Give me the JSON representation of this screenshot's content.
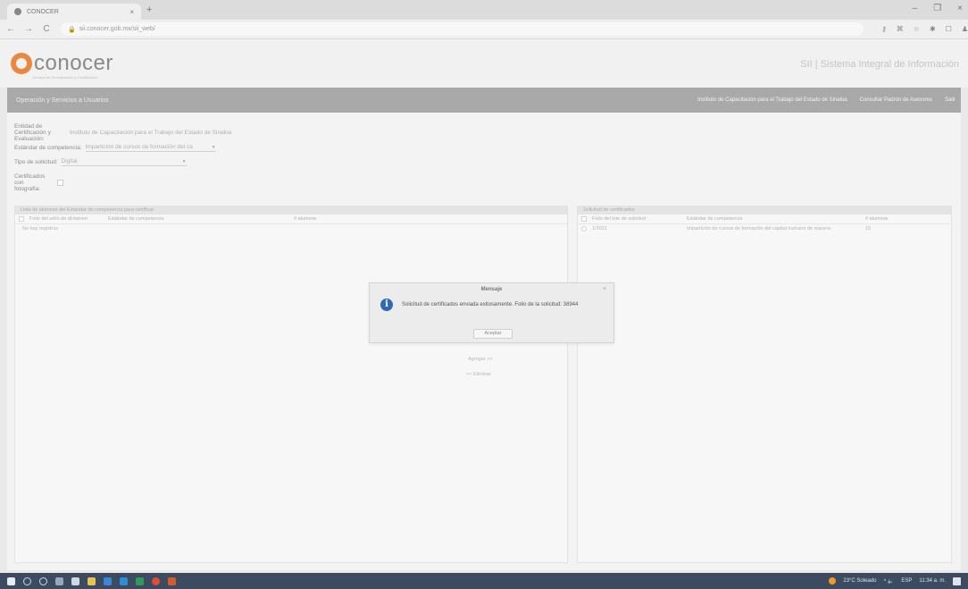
{
  "browser": {
    "tab_title": "CONOCER",
    "tab_close": "×",
    "new_tab": "+",
    "url": "sii.conocer.gob.mx/sii_web/",
    "nav": {
      "back": "←",
      "forward": "→",
      "reload": "C"
    },
    "window_controls": {
      "minimize": "–",
      "maximize": "❐",
      "close": "×"
    }
  },
  "header": {
    "logo_text": "conocer",
    "logo_subtitle": "Consejo de Normalización y Certificación",
    "system_title": "SII | Sistema Integral de Información"
  },
  "menubar": {
    "left_item": "Operación y Servicios a Usuarios",
    "right_items": [
      "Instituto de Capacitación para el Trabajo del Estado de Sinaloa",
      "Consultar Padrón de Asesores",
      "Salir"
    ]
  },
  "form": {
    "entity_label": "Entidad de Certificación y Evaluación:",
    "entity_value": "Instituto de Capacitación para el Trabajo del Estado de Sinaloa",
    "standard_label": "Estándar de competencia:",
    "standard_value": "Impartición de cursos de formación del ca",
    "request_type_label": "Tipo de solicitud:",
    "request_type_value": "Digital",
    "photo_label": "Certificados con fotografía:"
  },
  "left_panel": {
    "title": "Lista de alumnos del Estándar de competencia para certificar",
    "columns": [
      "Folio del sello de dictamen",
      "Estándar de competencia",
      "# alumnos"
    ],
    "empty_text": "No hay registros"
  },
  "right_panel": {
    "title": "Solicitud de certificados",
    "columns": [
      "Folio del lote de solicitud",
      "Estándar de competencia",
      "# alumnos"
    ],
    "rows": [
      {
        "folio": "1/2021",
        "standard": "Impartición de cursos de formación del capital humano de manera",
        "count": "15"
      }
    ]
  },
  "links": {
    "add": "Agregar >>",
    "remove": "<< Eliminar"
  },
  "modal": {
    "title": "Mensaje",
    "close": "×",
    "icon": "info-icon",
    "message": "Solicitud de certificados enviada exitosamente. Folio de la solicitud: 38944",
    "button": "Aceptar"
  },
  "taskbar": {
    "weather": "23°C Soleado",
    "language": "ESP",
    "time": "11:34 a. m.",
    "tray_symbols": "^  🔈"
  },
  "colors": {
    "menubar": "#a9a9a9",
    "logo_orange": "#e8893f",
    "info_blue": "#2f6ab3",
    "taskbar": "#3c4b60"
  }
}
